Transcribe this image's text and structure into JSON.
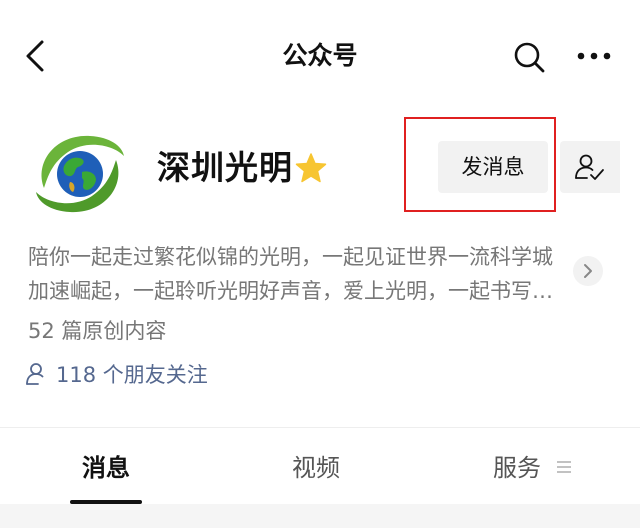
{
  "nav": {
    "title": "公众号"
  },
  "account": {
    "name": "深圳光明",
    "send_message_label": "发消息",
    "description": "陪你一起走过繁花似锦的光明，一起见证世界一流科学城加速崛起，一起聆听光明好声音，爱上光明，一起书写光明新篇章",
    "original_count": "52 篇原创内容",
    "friends_follow": "118 个朋友关注"
  },
  "tabs": [
    {
      "label": "消息"
    },
    {
      "label": "视频"
    },
    {
      "label": "服务"
    }
  ],
  "colors": {
    "highlight": "#e02020",
    "star": "#f7c531",
    "link": "#55688f"
  },
  "icons": {
    "back": "chevron-left-icon",
    "search": "search-icon",
    "more": "more-dots-icon",
    "star": "star-icon",
    "follow": "user-check-icon",
    "expand": "chevron-right-icon",
    "friends": "user-icon",
    "menu": "menu-lines-icon"
  }
}
